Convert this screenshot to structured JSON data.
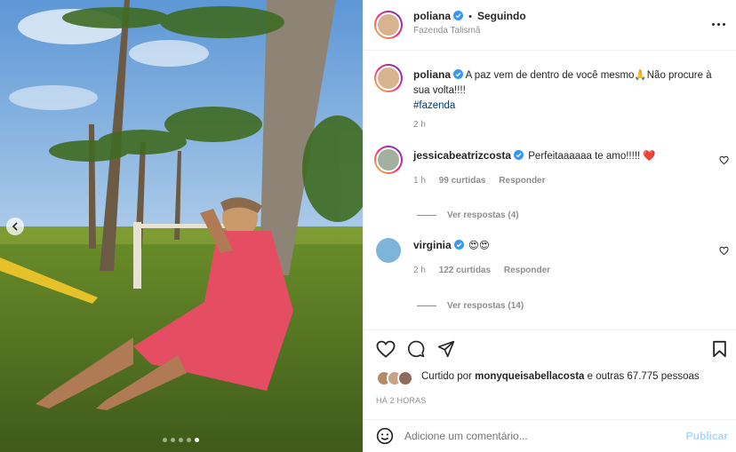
{
  "post": {
    "photo_page_count": 5,
    "photo_active_index": 4
  },
  "header": {
    "username": "poliana",
    "separator": "•",
    "follow_status": "Seguindo",
    "location": "Fazenda Talismã"
  },
  "caption": {
    "username": "poliana",
    "text": "A paz vem de dentro de você mesmo🙏Não procure à",
    "text_line2": "sua volta!!!!",
    "hashtag": "#fazenda",
    "time": "2 h"
  },
  "comments": [
    {
      "username": "jessicabeatrizcosta",
      "text": "Perfeitaaaaaa te amo!!!!! ❤️",
      "time": "1 h",
      "likes": "99 curtidas",
      "reply": "Responder",
      "view_replies": "Ver respostas (4)"
    },
    {
      "username": "virginia",
      "text": "😍😍",
      "time": "2 h",
      "likes": "122 curtidas",
      "reply": "Responder",
      "view_replies": "Ver respostas (14)"
    }
  ],
  "likes_summary": {
    "prefix": "Curtido por",
    "user": "monyqueisabellacosta",
    "suffix": "e outras 67.775 pessoas"
  },
  "timestamp": "HÁ 2 HORAS",
  "comment_box": {
    "placeholder": "Adicione um comentário...",
    "publish_label": "Publicar"
  },
  "colors": {
    "accent_blue": "#0095f6",
    "verified_blue": "#3897f0",
    "red_heart": "#ed4956"
  }
}
